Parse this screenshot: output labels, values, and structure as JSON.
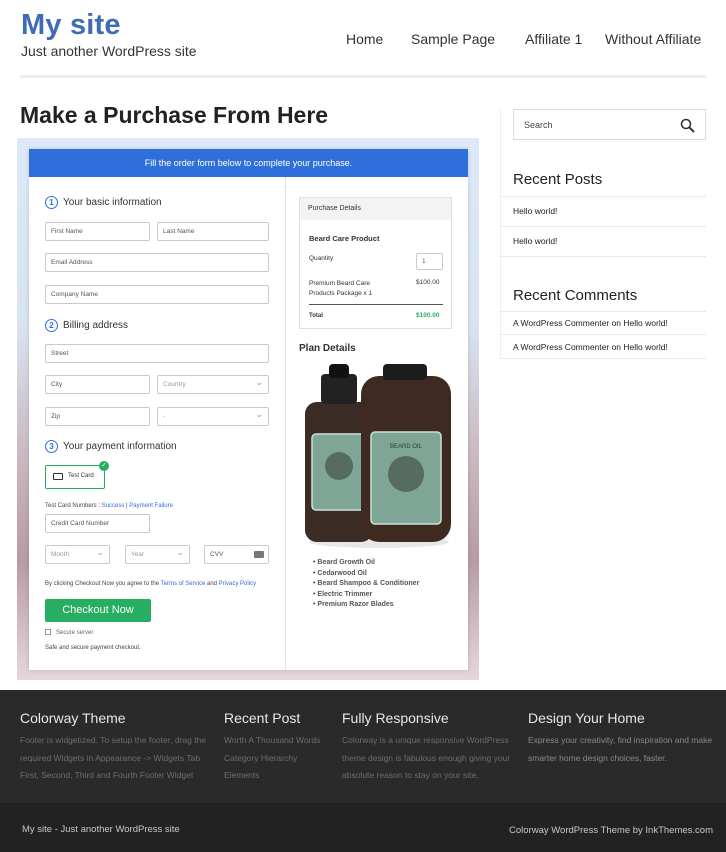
{
  "header": {
    "site_title": "My site",
    "tagline": "Just another WordPress site",
    "nav": [
      "Home",
      "Sample Page",
      "Affiliate 1",
      "Without Affiliate"
    ]
  },
  "page": {
    "title": "Make a Purchase From Here"
  },
  "form": {
    "banner": "Fill the order form below to complete your purchase.",
    "sec1": {
      "num": "1",
      "title": "Your basic information"
    },
    "first_name": "First Name",
    "last_name": "Last Name",
    "email": "Email Address",
    "company": "Company Name",
    "sec2": {
      "num": "2",
      "title": "Billing address"
    },
    "street": "Street",
    "city": "City",
    "country": "Country",
    "zip": "Zip",
    "state": "-",
    "sec3": {
      "num": "3",
      "title": "Your payment information"
    },
    "test_card": "Test Card",
    "test_numbers_label": "Test Card Numbers : ",
    "success": "Success",
    "separator": " | ",
    "failure": "Payment Failure",
    "card_number": "Credit Card Number",
    "month": "Month",
    "year": "Year",
    "cvv": "CVV",
    "terms_prefix": "By clicking Checkout Now you agree to the ",
    "terms": "Terms of Service",
    "and": " and ",
    "privacy": "Privacy Policy",
    "checkout": "Checkout Now",
    "secure": "Secure server",
    "safe": "Safe and secure payment checkout."
  },
  "purchase": {
    "head": "Purchase Details",
    "product": "Beard Care Product",
    "qty_label": "Quantity",
    "qty": "1",
    "item": "Premium Beard Care Products Package x 1",
    "item_price": "$100.00",
    "total_label": "Total",
    "total": "$100.00",
    "plan_title": "Plan Details",
    "features": [
      "Beard Growth Oil",
      "Cedarwood Oil",
      "Beard Shampoo & Conditioner",
      "Electric Trimmer",
      "Premium Razor Blades"
    ],
    "bottle_label": "BEARD OIL"
  },
  "sidebar": {
    "search_placeholder": "Search",
    "recent_posts_title": "Recent Posts",
    "posts": [
      "Hello world!",
      "Hello world!"
    ],
    "recent_comments_title": "Recent Comments",
    "comments": [
      {
        "author": "A WordPress Commenter",
        "on": " on ",
        "post": "Hello world!"
      },
      {
        "author": "A WordPress Commenter",
        "on": " on ",
        "post": "Hello world!"
      }
    ]
  },
  "footer": {
    "col1": {
      "title": "Colorway Theme",
      "text": "Footer is widgetized. To setup the footer, drag the required Widgets in Appearance -> Widgets Tab First, Second, Third and Fourth Footer Widget"
    },
    "col2": {
      "title": "Recent Post",
      "text": "Worth A Thousand Words Category Hierarchy Elements"
    },
    "col3": {
      "title": "Fully Responsive",
      "text": "Colorway is a unique responsive WordPress theme design is fabulous enough giving your absolute reason to stay on your site."
    },
    "col4": {
      "title": "Design Your Home",
      "text": "Express your creativity, find inspiration and make smarter home design choices, faster."
    },
    "bottom_left": "My site - Just another WordPress site",
    "bottom_right": "Colorway WordPress Theme by InkThemes.com"
  },
  "colors": {
    "brand": "#3f6ab4",
    "accent": "#2f6fdb",
    "button": "#27ae60",
    "total": "#27ae60"
  }
}
